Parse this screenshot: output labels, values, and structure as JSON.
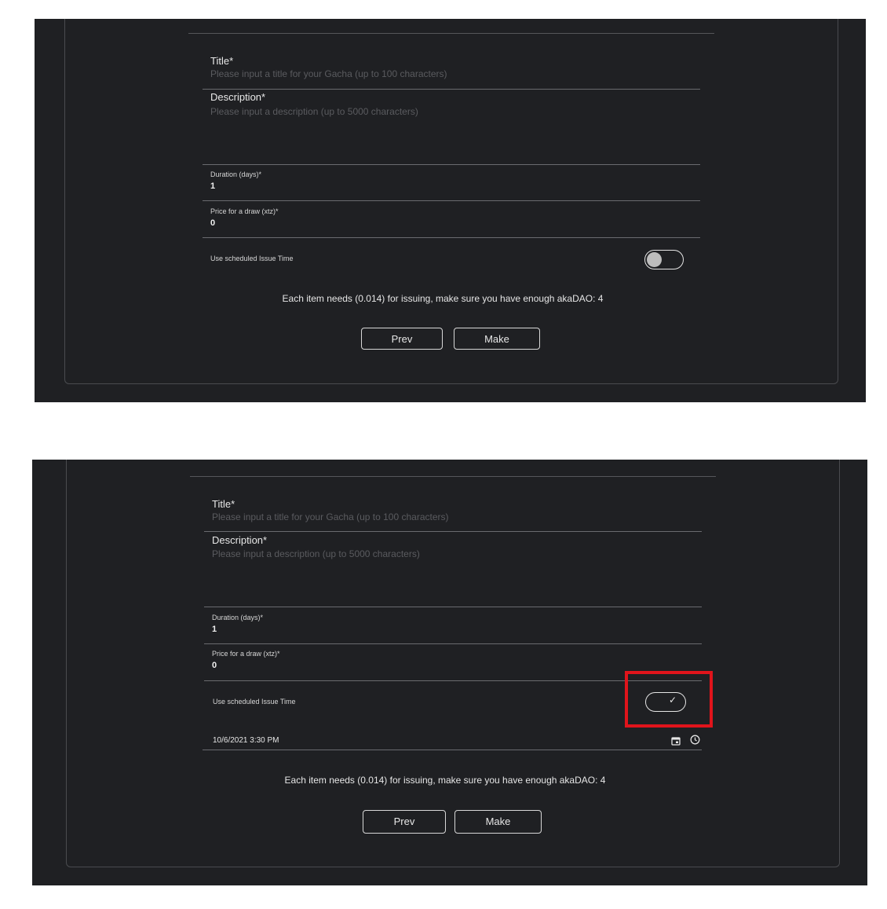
{
  "form": {
    "title_label": "Title*",
    "title_placeholder": "Please input a title for your Gacha (up to 100 characters)",
    "description_label": "Description*",
    "description_placeholder": "Please input a description (up to 5000 characters)",
    "duration_label": "Duration (days)*",
    "duration_value": "1",
    "price_label": "Price for a draw (xtz)*",
    "price_value": "0",
    "scheduled_label": "Use scheduled Issue Time",
    "notice": "Each item needs (0.014) for issuing, make sure you have enough akaDAO: 4",
    "prev_label": "Prev",
    "make_label": "Make"
  },
  "states": [
    {
      "scheduled_enabled": false
    },
    {
      "scheduled_enabled": true,
      "scheduled_datetime": "10/6/2021 3:30 PM"
    }
  ],
  "colors": {
    "background": "#1f2023",
    "highlight": "#e0141b",
    "text": "#e6e6e6",
    "placeholder": "#5a5b5f"
  },
  "icons": [
    "calendar-icon",
    "clock-icon",
    "checkmark-icon"
  ]
}
